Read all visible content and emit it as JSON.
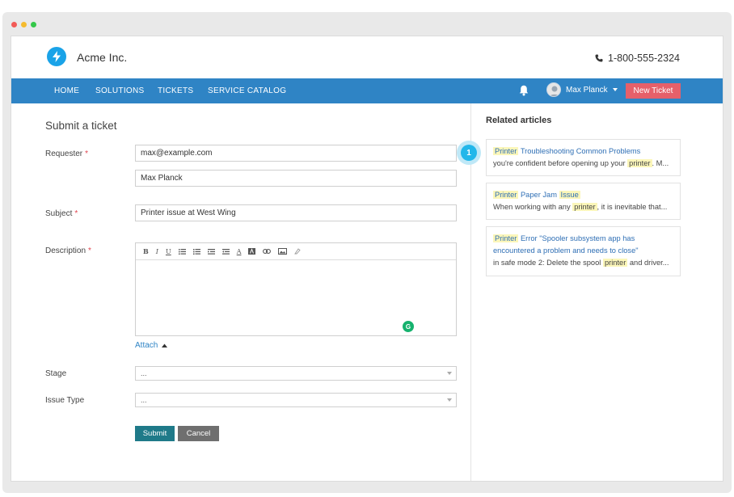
{
  "app": {
    "name": "Acme Inc.",
    "phone": "1-800-555-2324",
    "brand_color": "#2f84c5"
  },
  "nav": {
    "items": [
      "HOME",
      "SOLUTIONS",
      "TICKETS",
      "SERVICE CATALOG"
    ],
    "user_name": "Max Planck",
    "new_ticket_label": "New Ticket"
  },
  "form": {
    "title": "Submit a ticket",
    "requester_label": "Requester",
    "requester_email": "max@example.com",
    "requester_name": "Max Planck",
    "subject_label": "Subject",
    "subject_value": "Printer issue at West Wing",
    "description_label": "Description",
    "toolbar_icons": [
      "bold-icon",
      "italic-icon",
      "underline-icon",
      "bullet-list-icon",
      "numbered-list-icon",
      "outdent-icon",
      "indent-icon",
      "font-color-icon",
      "background-color-icon",
      "link-icon",
      "image-icon",
      "clear-format-icon"
    ],
    "attach_label": "Attach",
    "stage_label": "Stage",
    "stage_value": "...",
    "issue_type_label": "Issue Type",
    "issue_type_value": "...",
    "submit_label": "Submit",
    "cancel_label": "Cancel",
    "required_marker": "*"
  },
  "related": {
    "title": "Related articles",
    "badge": "1",
    "articles": [
      {
        "title_highlight": "Printer",
        "title_rest": "Troubleshooting Common Problems",
        "snippet_pre": "you're confident before opening up your",
        "snippet_highlight": "printer",
        "snippet_post": ". M..."
      },
      {
        "title_highlight": "Printer",
        "title_mid": "Paper Jam",
        "title_highlight2": "Issue",
        "snippet_pre": "When working with any",
        "snippet_highlight": "printer",
        "snippet_post": ", it is inevitable that..."
      },
      {
        "title_highlight": "Printer",
        "title_rest": "Error \"Spooler subsystem app has encountered a problem and needs to close\"",
        "snippet_pre": "in safe mode 2: Delete the spool",
        "snippet_highlight": "printer",
        "snippet_post": "and driver..."
      }
    ]
  }
}
